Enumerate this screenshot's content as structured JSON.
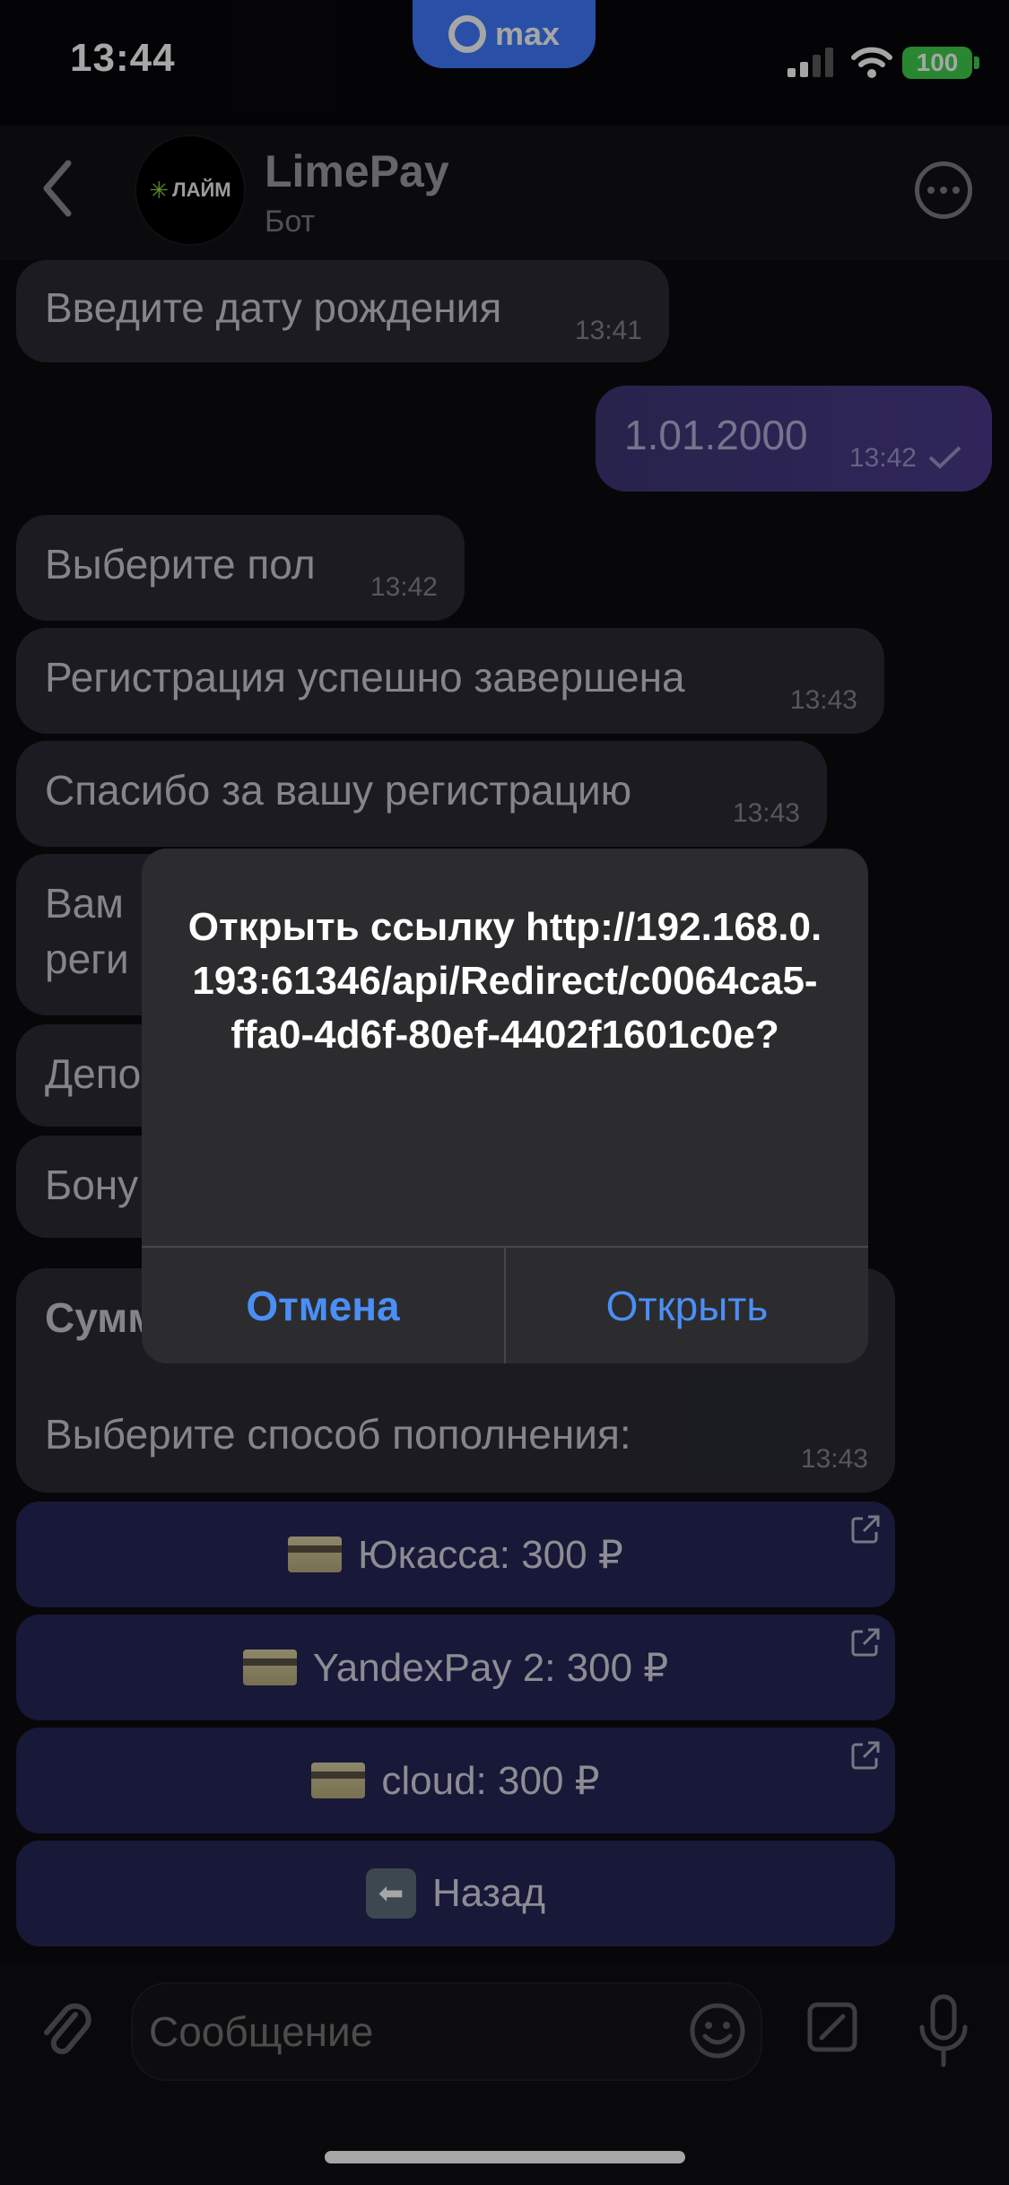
{
  "status": {
    "time": "13:44",
    "app_pill": "max",
    "battery": "100"
  },
  "header": {
    "title": "LimePay",
    "subtitle": "Бот",
    "avatar_text": "ЛАЙМ"
  },
  "messages": [
    {
      "text": "Введите дату рождения",
      "time": "13:41",
      "direction": "in"
    },
    {
      "text": "1.01.2000",
      "time": "13:42",
      "direction": "out"
    },
    {
      "text": "Выберите пол",
      "time": "13:42",
      "direction": "in"
    },
    {
      "text": "Регистрация успешно завершена",
      "time": "13:43",
      "direction": "in"
    },
    {
      "text": "Спасибо за вашу регистрацию",
      "time": "13:43",
      "direction": "in"
    },
    {
      "text_line1": "Вам",
      "text_line2": "реги",
      "direction": "in"
    },
    {
      "text": "Депо",
      "direction": "in"
    },
    {
      "text": "Бону",
      "direction": "in"
    },
    {
      "title": "Сумм",
      "text": "Выберите способ пополнения:",
      "time": "13:43",
      "direction": "in"
    }
  ],
  "keyboard": [
    {
      "label": "Юкасса: 300 ₽",
      "icon": "credit-card-icon",
      "external": true
    },
    {
      "label": "YandexPay 2: 300 ₽",
      "icon": "credit-card-icon",
      "external": true
    },
    {
      "label": "cloud: 300 ₽",
      "icon": "credit-card-icon",
      "external": true
    },
    {
      "label": "Назад",
      "icon": "back-arrow-icon",
      "external": false
    }
  ],
  "dialog": {
    "text": "Открыть ссылку http://192.168.0.193:61346/api/Redirect/c0064ca5-ffa0-4d6f-80ef-4402f1601c0e?",
    "cancel": "Отмена",
    "open": "Открыть"
  },
  "input": {
    "placeholder": "Сообщение"
  },
  "colors": {
    "accent": "#4b8ef5",
    "bubble": "#2a2a34",
    "keyboard_button": "#262656",
    "battery": "#3ecf4a"
  }
}
